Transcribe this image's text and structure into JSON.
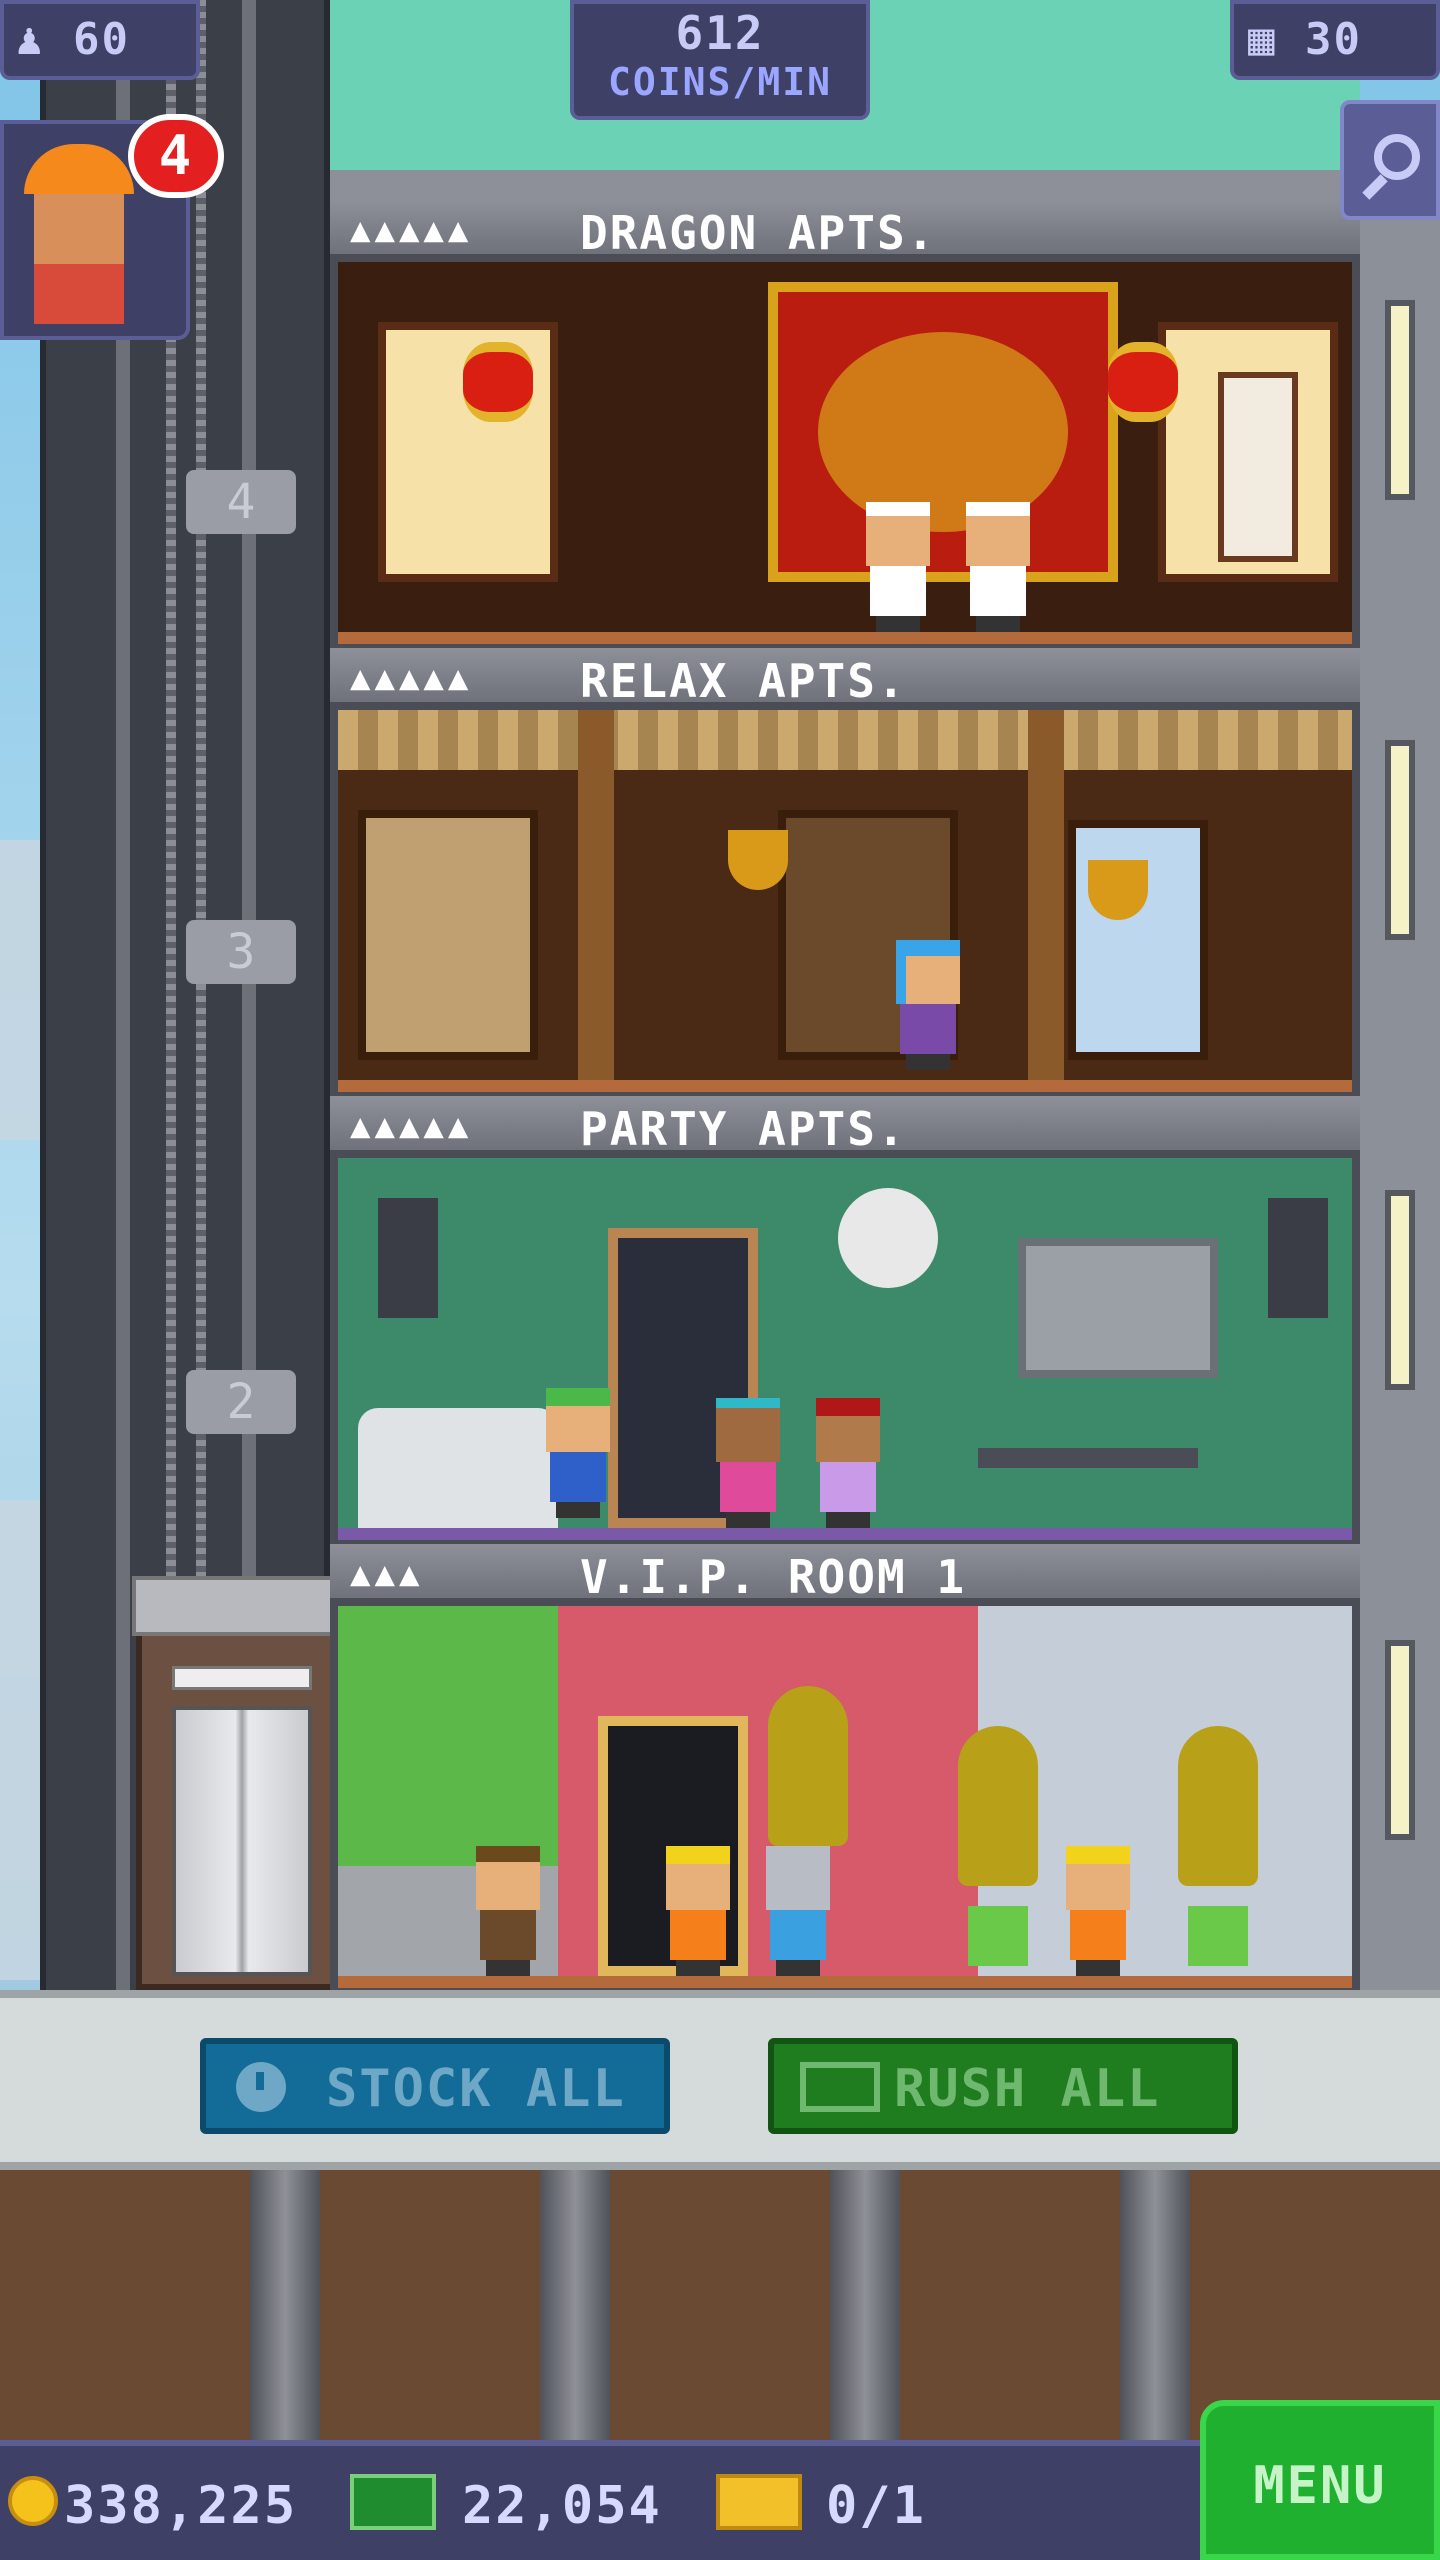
{
  "hud": {
    "population": "60",
    "coins_per_min_value": "612",
    "coins_per_min_unit": "COINS/MIN",
    "floor_count": "30",
    "worker_badge": "4"
  },
  "floors": [
    {
      "name": "DRAGON APTS.",
      "residents": "▲▲▲▲▲",
      "shaft_number": "4"
    },
    {
      "name": "RELAX APTS.",
      "residents": "▲▲▲▲▲",
      "shaft_number": "3"
    },
    {
      "name": "PARTY APTS.",
      "residents": "▲▲▲▲▲",
      "shaft_number": "2"
    },
    {
      "name": "V.I.P. ROOM 1",
      "residents": "▲▲▲",
      "shaft_number": ""
    }
  ],
  "actions": {
    "stock_all": "STOCK ALL",
    "rush_all": "RUSH ALL"
  },
  "resources": {
    "coins": "338,225",
    "bux": "22,054",
    "tickets": "0/1"
  },
  "menu_label": "MENU",
  "icons": {
    "population": "person-icon",
    "floors": "building-icon",
    "search": "magnifier-icon",
    "stock": "clock-icon",
    "rush": "bux-icon",
    "coin": "coin-icon",
    "ticket": "ticket-icon"
  },
  "colors": {
    "hud_bg": "#3e4065",
    "stock_button": "#136b98",
    "rush_button": "#1f7d1f",
    "menu_button": "#1fb02f",
    "badge": "#e41f1f"
  }
}
